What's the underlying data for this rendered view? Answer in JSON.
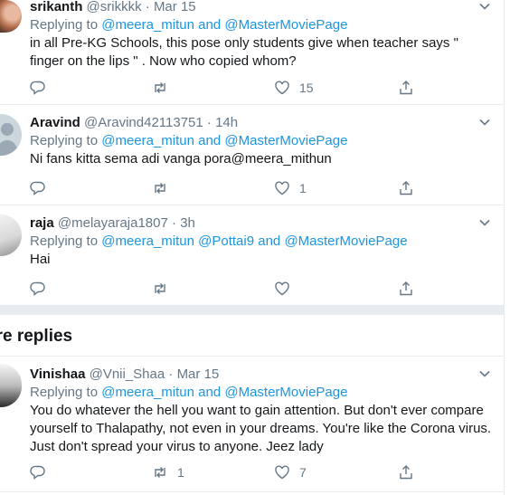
{
  "tweets": [
    {
      "name": "srikanth",
      "handle": "@srikkkk",
      "time": "Mar 15",
      "replying_prefix": "Replying to",
      "mentions": "@meera_mitun and @MasterMoviePage",
      "text": "in all Pre-KG Schools, this pose only students give when teacher says \" finger on the lips \" . Now who copied whom?",
      "replies": "",
      "retweets": "",
      "likes": "15"
    },
    {
      "name": "Aravind",
      "handle": "@Aravind42113751",
      "time": "14h",
      "replying_prefix": "Replying to",
      "mentions": "@meera_mitun and @MasterMoviePage",
      "text": "Ni fans kitta sema adi vanga pora@meera_mithun",
      "replies": "",
      "retweets": "",
      "likes": "1"
    },
    {
      "name": "raja",
      "handle": "@melayaraja1807",
      "time": "3h",
      "replying_prefix": "Replying to",
      "mentions": "@meera_mitun @Pottai9 and @MasterMoviePage",
      "text": "Hai",
      "replies": "",
      "retweets": "",
      "likes": ""
    },
    {
      "name": "Vinishaa",
      "handle": "@Vnii_Shaa",
      "time": "Mar 15",
      "replying_prefix": "Replying to",
      "mentions": "@meera_mitun and @MasterMoviePage",
      "text": "You do whatever the hell you want to gain attention. But don't ever compare yourself to Thalapathy, not even in your dreams. You're like the Corona virus. Just don't spread your virus to anyone. Jeez lady",
      "replies": "",
      "retweets": "1",
      "likes": "7"
    }
  ],
  "section_title": "ore replies",
  "dot": "·",
  "colors": {
    "link": "#1b95e0",
    "muted": "#657786",
    "divider": "#e6ecf0"
  }
}
